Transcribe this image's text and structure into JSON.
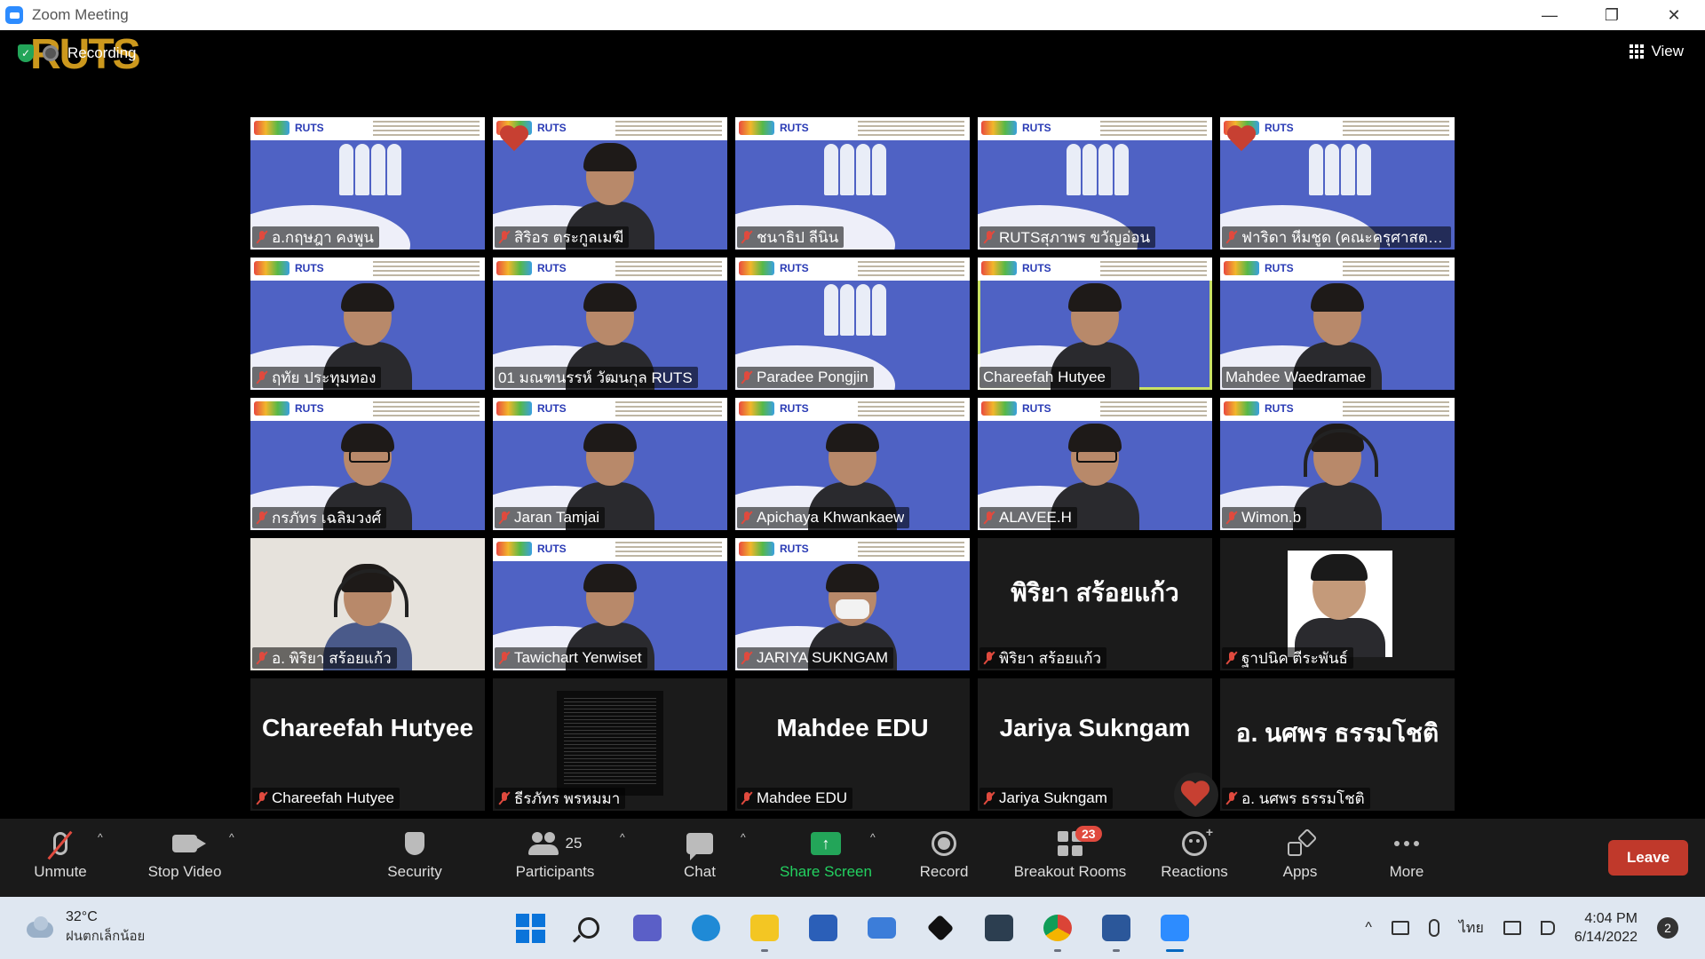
{
  "window": {
    "title": "Zoom Meeting",
    "controls": [
      "—",
      "❐",
      "✕"
    ]
  },
  "meeting": {
    "recording_label": "Recording",
    "view_label": "View",
    "logo_text": "RUTS"
  },
  "tiles": [
    {
      "name": "อ.กฤษฎา คงพูน",
      "type": "bg",
      "heart": false
    },
    {
      "name": "สิริอร ตระกูลเมฆี",
      "type": "bg-person",
      "heart": true
    },
    {
      "name": "ชนาธิป ลีนิน",
      "type": "bg",
      "heart": false
    },
    {
      "name": "RUTSสุภาพร ขวัญอ่อน",
      "type": "bg",
      "heart": false
    },
    {
      "name": "ฟาริดา หีมชูด (คณะครุศาสตร์...",
      "type": "bg",
      "heart": true
    },
    {
      "name": "ฤทัย ประทุมทอง",
      "type": "bg-person",
      "heart": false
    },
    {
      "name": "01 มณฑนรรห์ วัฒนกุล RUTS",
      "type": "bg-person",
      "heart": false
    },
    {
      "name": "Paradee Pongjin",
      "type": "bg",
      "heart": false
    },
    {
      "name": "Chareefah Hutyee",
      "type": "bg-person",
      "heart": false,
      "active": true
    },
    {
      "name": "Mahdee Waedramae",
      "type": "bg-person",
      "heart": false
    },
    {
      "name": "กรภัทร เฉลิมวงศ์",
      "type": "bg-person",
      "heart": false
    },
    {
      "name": "Jaran Tamjai",
      "type": "bg-person",
      "heart": false
    },
    {
      "name": "Apichaya Khwankaew",
      "type": "bg-person",
      "heart": false
    },
    {
      "name": "ALAVEE.H",
      "type": "bg-person",
      "heart": false
    },
    {
      "name": "Wimon.b",
      "type": "bg-person",
      "heart": false
    },
    {
      "name": "อ. พิริยา สร้อยแก้ว",
      "type": "video",
      "heart": false
    },
    {
      "name": "Tawichart Yenwiset",
      "type": "bg-person",
      "heart": false
    },
    {
      "name": "JARIYA SUKNGAM",
      "type": "bg-person",
      "heart": false
    },
    {
      "name": "พิริยา สร้อยแก้ว",
      "type": "text",
      "big": "พิริยา สร้อยแก้ว"
    },
    {
      "name": "ฐาปนิค ตีระพันธ์",
      "type": "photo"
    },
    {
      "name": "Chareefah Hutyee",
      "type": "text",
      "big": "Chareefah Hutyee"
    },
    {
      "name": "ธีรภัทร พรหมมา",
      "type": "screen"
    },
    {
      "name": "Mahdee EDU",
      "type": "text",
      "big": "Mahdee EDU"
    },
    {
      "name": "Jariya Sukngam",
      "type": "text",
      "big": "Jariya Sukngam"
    },
    {
      "name": "อ. นศพร ธรรมโชติ",
      "type": "text",
      "big": "อ. นศพร ธรรมโชติ"
    }
  ],
  "toolbar": {
    "unmute": "Unmute",
    "stop_video": "Stop Video",
    "security": "Security",
    "participants": "Participants",
    "participants_count": "25",
    "chat": "Chat",
    "share_screen": "Share Screen",
    "share_arrow": "↑",
    "record": "Record",
    "breakout_rooms": "Breakout Rooms",
    "breakout_badge": "23",
    "reactions": "Reactions",
    "apps": "Apps",
    "more": "More",
    "leave": "Leave",
    "caret": "^"
  },
  "taskbar": {
    "temperature": "32°C",
    "weather_text": "ฝนตกเล็กน้อย",
    "language": "ไทย",
    "time": "4:04 PM",
    "date": "6/14/2022",
    "notifications": "2",
    "tray_caret": "^"
  },
  "colors": {
    "accent_green": "#23a559",
    "leave_red": "#c0392b",
    "muted_red": "#e04a3e",
    "active_border": "#c9e265",
    "bg_blue": "#4f62c4"
  }
}
